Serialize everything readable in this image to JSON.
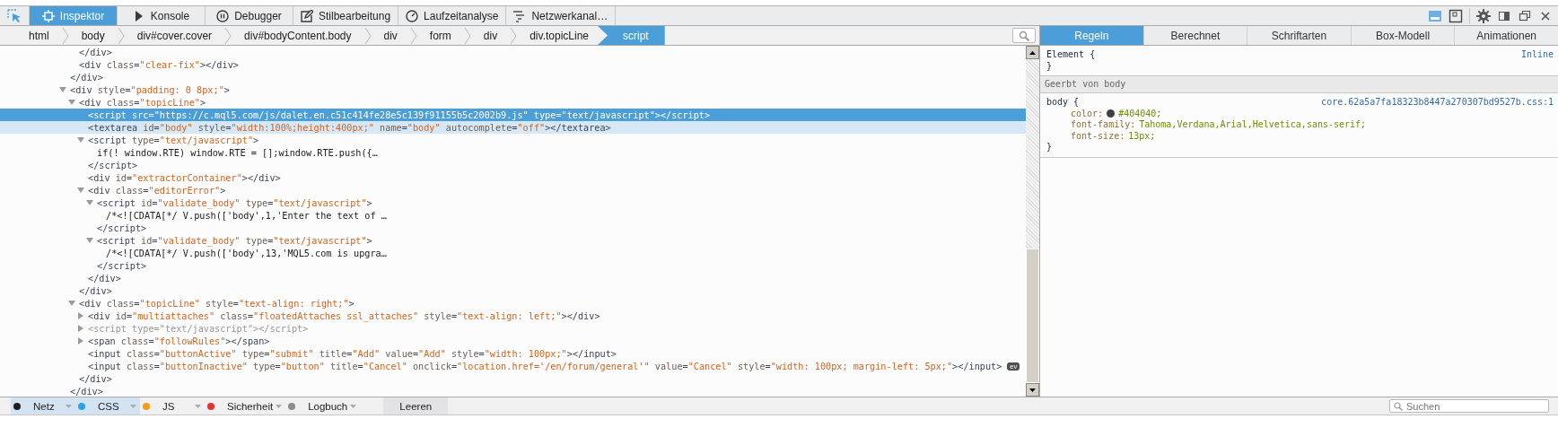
{
  "toolbar": {
    "tabs": [
      {
        "label": "Inspektor",
        "selected": true
      },
      {
        "label": "Konsole",
        "selected": false
      },
      {
        "label": "Debugger",
        "selected": false
      },
      {
        "label": "Stilbearbeitung",
        "selected": false
      },
      {
        "label": "Laufzeitanalyse",
        "selected": false
      },
      {
        "label": "Netzwerkanal…",
        "selected": false
      }
    ]
  },
  "breadcrumbs": [
    {
      "label": "html",
      "selected": false
    },
    {
      "label": "body",
      "selected": false
    },
    {
      "label": "div#cover.cover",
      "selected": false
    },
    {
      "label": "div#bodyContent.body",
      "selected": false
    },
    {
      "label": "div",
      "selected": false
    },
    {
      "label": "form",
      "selected": false
    },
    {
      "label": "div",
      "selected": false
    },
    {
      "label": "div.topicLine",
      "selected": false
    },
    {
      "label": "script",
      "selected": true
    }
  ],
  "markup": [
    {
      "children": [
        {
          "line": [
            {
              "kind": "tag",
              "text": "</div>"
            }
          ],
          "selected": false,
          "hovered": false,
          "dimmed": false
        },
        {
          "line": [
            {
              "kind": "tag",
              "text": "<div"
            },
            {
              "kind": "attr",
              "text": " class"
            },
            {
              "kind": "tag",
              "text": "="
            },
            {
              "kind": "val",
              "text": "\"clear-fix\""
            },
            {
              "kind": "tag",
              "text": "></div>"
            }
          ],
          "selected": false,
          "hovered": false,
          "dimmed": false
        }
      ],
      "close": [
        {
          "kind": "tag",
          "text": "</div>"
        }
      ]
    },
    {
      "line": [
        {
          "kind": "tag",
          "text": "<div"
        },
        {
          "kind": "attr",
          "text": " style"
        },
        {
          "kind": "tag",
          "text": "="
        },
        {
          "kind": "val",
          "text": "\"padding: 0 8px;\""
        },
        {
          "kind": "tag",
          "text": ">"
        }
      ],
      "selected": false,
      "hovered": false,
      "dimmed": false,
      "expanded": true,
      "children": [
        {
          "line": [
            {
              "kind": "tag",
              "text": "<div"
            },
            {
              "kind": "attr",
              "text": " class"
            },
            {
              "kind": "tag",
              "text": "="
            },
            {
              "kind": "val",
              "text": "\"topicLine\""
            },
            {
              "kind": "tag",
              "text": ">"
            }
          ],
          "selected": false,
          "hovered": false,
          "dimmed": false,
          "expanded": true,
          "children": [
            {
              "line": [
                {
                  "kind": "tag",
                  "text": "<script"
                },
                {
                  "kind": "attr",
                  "text": " src"
                },
                {
                  "kind": "tag",
                  "text": "="
                },
                {
                  "kind": "val",
                  "text": "\"https://c.mql5.com/js/dalet.en.c51c414fe28e5c139f91155b5c2002b9.js\""
                },
                {
                  "kind": "attr",
                  "text": " type"
                },
                {
                  "kind": "tag",
                  "text": "="
                },
                {
                  "kind": "val",
                  "text": "\"text/javascript\""
                },
                {
                  "kind": "tag",
                  "text": "></script>"
                }
              ],
              "selected": true,
              "hovered": false,
              "dimmed": false
            },
            {
              "line": [
                {
                  "kind": "tag",
                  "text": "<textarea"
                },
                {
                  "kind": "attr",
                  "text": " id"
                },
                {
                  "kind": "tag",
                  "text": "="
                },
                {
                  "kind": "val",
                  "text": "\"body\""
                },
                {
                  "kind": "attr",
                  "text": " style"
                },
                {
                  "kind": "tag",
                  "text": "="
                },
                {
                  "kind": "val",
                  "text": "\"width:100%;height:400px;\""
                },
                {
                  "kind": "attr",
                  "text": " name"
                },
                {
                  "kind": "tag",
                  "text": "="
                },
                {
                  "kind": "val",
                  "text": "\"body\""
                },
                {
                  "kind": "attr",
                  "text": " autocomplete"
                },
                {
                  "kind": "tag",
                  "text": "="
                },
                {
                  "kind": "val",
                  "text": "\"off\""
                },
                {
                  "kind": "tag",
                  "text": "></textarea>"
                }
              ],
              "selected": false,
              "hovered": true,
              "dimmed": false
            },
            {
              "line": [
                {
                  "kind": "tag",
                  "text": "<script"
                },
                {
                  "kind": "attr",
                  "text": " type"
                },
                {
                  "kind": "tag",
                  "text": "="
                },
                {
                  "kind": "val",
                  "text": "\"text/javascript\""
                },
                {
                  "kind": "tag",
                  "text": ">"
                }
              ],
              "selected": false,
              "hovered": false,
              "dimmed": false,
              "expanded": true,
              "children": [
                {
                  "line": [
                    {
                      "kind": "text",
                      "text": "if(! window.RTE) window.RTE = [];window.RTE.push({…"
                    }
                  ],
                  "selected": false,
                  "hovered": false,
                  "dimmed": false
                }
              ],
              "close": [
                {
                  "kind": "tag",
                  "text": "</script>"
                }
              ]
            },
            {
              "line": [
                {
                  "kind": "tag",
                  "text": "<div"
                },
                {
                  "kind": "attr",
                  "text": " id"
                },
                {
                  "kind": "tag",
                  "text": "="
                },
                {
                  "kind": "val",
                  "text": "\"extractorContainer\""
                },
                {
                  "kind": "tag",
                  "text": "></div>"
                }
              ],
              "selected": false,
              "hovered": false,
              "dimmed": false
            },
            {
              "line": [
                {
                  "kind": "tag",
                  "text": "<div"
                },
                {
                  "kind": "attr",
                  "text": " class"
                },
                {
                  "kind": "tag",
                  "text": "="
                },
                {
                  "kind": "val",
                  "text": "\"editorError\""
                },
                {
                  "kind": "tag",
                  "text": ">"
                }
              ],
              "selected": false,
              "hovered": false,
              "dimmed": false,
              "expanded": true,
              "children": [
                {
                  "line": [
                    {
                      "kind": "tag",
                      "text": "<script"
                    },
                    {
                      "kind": "attr",
                      "text": " id"
                    },
                    {
                      "kind": "tag",
                      "text": "="
                    },
                    {
                      "kind": "val",
                      "text": "\"validate_body\""
                    },
                    {
                      "kind": "attr",
                      "text": " type"
                    },
                    {
                      "kind": "tag",
                      "text": "="
                    },
                    {
                      "kind": "val",
                      "text": "\"text/javascript\""
                    },
                    {
                      "kind": "tag",
                      "text": ">"
                    }
                  ],
                  "selected": false,
                  "hovered": false,
                  "dimmed": false,
                  "expanded": true,
                  "children": [
                    {
                      "line": [
                        {
                          "kind": "text",
                          "text": "/*<![CDATA[*/ V.push(['body',1,'Enter the text of …"
                        }
                      ],
                      "selected": false,
                      "hovered": false,
                      "dimmed": false
                    }
                  ],
                  "close": [
                    {
                      "kind": "tag",
                      "text": "</script>"
                    }
                  ]
                },
                {
                  "line": [
                    {
                      "kind": "tag",
                      "text": "<script"
                    },
                    {
                      "kind": "attr",
                      "text": " id"
                    },
                    {
                      "kind": "tag",
                      "text": "="
                    },
                    {
                      "kind": "val",
                      "text": "\"validate_body\""
                    },
                    {
                      "kind": "attr",
                      "text": " type"
                    },
                    {
                      "kind": "tag",
                      "text": "="
                    },
                    {
                      "kind": "val",
                      "text": "\"text/javascript\""
                    },
                    {
                      "kind": "tag",
                      "text": ">"
                    }
                  ],
                  "selected": false,
                  "hovered": false,
                  "dimmed": false,
                  "expanded": true,
                  "children": [
                    {
                      "line": [
                        {
                          "kind": "text",
                          "text": "/*<![CDATA[*/ V.push(['body',13,'MQL5.com is upgra…"
                        }
                      ],
                      "selected": false,
                      "hovered": false,
                      "dimmed": false
                    }
                  ],
                  "close": [
                    {
                      "kind": "tag",
                      "text": "</script>"
                    }
                  ]
                }
              ],
              "close": [
                {
                  "kind": "tag",
                  "text": "</div>"
                }
              ]
            }
          ],
          "close": [
            {
              "kind": "tag",
              "text": "</div>"
            }
          ]
        },
        {
          "line": [
            {
              "kind": "tag",
              "text": "<div"
            },
            {
              "kind": "attr",
              "text": " class"
            },
            {
              "kind": "tag",
              "text": "="
            },
            {
              "kind": "val",
              "text": "\"topicLine\""
            },
            {
              "kind": "attr",
              "text": " style"
            },
            {
              "kind": "tag",
              "text": "="
            },
            {
              "kind": "val",
              "text": "\"text-align: right;\""
            },
            {
              "kind": "tag",
              "text": ">"
            }
          ],
          "selected": false,
          "hovered": false,
          "dimmed": false,
          "expanded": true,
          "children": [
            {
              "line": [
                {
                  "kind": "tag",
                  "text": "<div"
                },
                {
                  "kind": "attr",
                  "text": " id"
                },
                {
                  "kind": "tag",
                  "text": "="
                },
                {
                  "kind": "val",
                  "text": "\"multiattaches\""
                },
                {
                  "kind": "attr",
                  "text": " class"
                },
                {
                  "kind": "tag",
                  "text": "="
                },
                {
                  "kind": "val",
                  "text": "\"floatedAttaches ssl_attaches\""
                },
                {
                  "kind": "attr",
                  "text": " style"
                },
                {
                  "kind": "tag",
                  "text": "="
                },
                {
                  "kind": "val",
                  "text": "\"text-align: left;\""
                },
                {
                  "kind": "tag",
                  "text": "></div>"
                }
              ],
              "selected": false,
              "hovered": false,
              "dimmed": false,
              "expanded": false
            },
            {
              "line": [
                {
                  "kind": "tag",
                  "text": "<script"
                },
                {
                  "kind": "attr",
                  "text": " type"
                },
                {
                  "kind": "tag",
                  "text": "="
                },
                {
                  "kind": "val",
                  "text": "\"text/javascript\""
                },
                {
                  "kind": "tag",
                  "text": "></script>"
                }
              ],
              "selected": false,
              "hovered": false,
              "dimmed": true,
              "expanded": false
            },
            {
              "line": [
                {
                  "kind": "tag",
                  "text": "<span"
                },
                {
                  "kind": "attr",
                  "text": " class"
                },
                {
                  "kind": "tag",
                  "text": "="
                },
                {
                  "kind": "val",
                  "text": "\"followRules\""
                },
                {
                  "kind": "tag",
                  "text": "></span>"
                }
              ],
              "selected": false,
              "hovered": false,
              "dimmed": false,
              "expanded": false
            },
            {
              "line": [
                {
                  "kind": "tag",
                  "text": "<input"
                },
                {
                  "kind": "attr",
                  "text": " class"
                },
                {
                  "kind": "tag",
                  "text": "="
                },
                {
                  "kind": "val",
                  "text": "\"buttonActive\""
                },
                {
                  "kind": "attr",
                  "text": " type"
                },
                {
                  "kind": "tag",
                  "text": "="
                },
                {
                  "kind": "val",
                  "text": "\"submit\""
                },
                {
                  "kind": "attr",
                  "text": " title"
                },
                {
                  "kind": "tag",
                  "text": "="
                },
                {
                  "kind": "val",
                  "text": "\"Add\""
                },
                {
                  "kind": "attr",
                  "text": " value"
                },
                {
                  "kind": "tag",
                  "text": "="
                },
                {
                  "kind": "val",
                  "text": "\"Add\""
                },
                {
                  "kind": "attr",
                  "text": " style"
                },
                {
                  "kind": "tag",
                  "text": "="
                },
                {
                  "kind": "val",
                  "text": "\"width: 100px;\""
                },
                {
                  "kind": "tag",
                  "text": "></input>"
                }
              ],
              "selected": false,
              "hovered": false,
              "dimmed": false
            },
            {
              "line": [
                {
                  "kind": "tag",
                  "text": "<input"
                },
                {
                  "kind": "attr",
                  "text": " class"
                },
                {
                  "kind": "tag",
                  "text": "="
                },
                {
                  "kind": "val",
                  "text": "\"buttonInactive\""
                },
                {
                  "kind": "attr",
                  "text": " type"
                },
                {
                  "kind": "tag",
                  "text": "="
                },
                {
                  "kind": "val",
                  "text": "\"button\""
                },
                {
                  "kind": "attr",
                  "text": " title"
                },
                {
                  "kind": "tag",
                  "text": "="
                },
                {
                  "kind": "val",
                  "text": "\"Cancel\""
                },
                {
                  "kind": "attr",
                  "text": " onclick"
                },
                {
                  "kind": "tag",
                  "text": "="
                },
                {
                  "kind": "val",
                  "text": "\"location.href='/en/forum/general'\""
                },
                {
                  "kind": "attr",
                  "text": " value"
                },
                {
                  "kind": "tag",
                  "text": "="
                },
                {
                  "kind": "val",
                  "text": "\"Cancel\""
                },
                {
                  "kind": "attr",
                  "text": " style"
                },
                {
                  "kind": "tag",
                  "text": "="
                },
                {
                  "kind": "val",
                  "text": "\"width: 100px; margin-left: 5px;\""
                },
                {
                  "kind": "tag",
                  "text": "></input>"
                }
              ],
              "selected": false,
              "hovered": false,
              "dimmed": false,
              "badge": "ev"
            }
          ],
          "close": [
            {
              "kind": "tag",
              "text": "</div>"
            }
          ]
        }
      ],
      "close": [
        {
          "kind": "tag",
          "text": "</div>"
        }
      ]
    }
  ],
  "sidebar": {
    "tabs": [
      {
        "label": "Regeln",
        "selected": true
      },
      {
        "label": "Berechnet",
        "selected": false
      },
      {
        "label": "Schriftarten",
        "selected": false
      },
      {
        "label": "Box-Modell",
        "selected": false
      },
      {
        "label": "Animationen",
        "selected": false
      }
    ],
    "rules": [
      {
        "kind": "rule",
        "selector": "Element {",
        "source": "Inline",
        "close": "}"
      },
      {
        "kind": "header",
        "text": "Geerbt von body"
      },
      {
        "kind": "rule",
        "selector": "body {",
        "source": "core.62a5a7fa18323b8447a270307bd9527b.css:1",
        "close": "}",
        "declarations": [
          {
            "property": "color:",
            "value": "#404040;",
            "color": "#404040"
          },
          {
            "property": "font-family:",
            "value": "Tahoma,Verdana,Arial,Helvetica,sans-serif;"
          },
          {
            "property": "font-size:",
            "value": "13px;"
          }
        ]
      }
    ]
  },
  "console": {
    "filters": [
      {
        "label": "Netz",
        "color": "#1e1e1e",
        "selected": true
      },
      {
        "label": "CSS",
        "color": "#2aa3e0",
        "selected": true
      },
      {
        "label": "JS",
        "color": "#f59a1b",
        "selected": false
      },
      {
        "label": "Sicherheit",
        "color": "#e8312f",
        "selected": false
      },
      {
        "label": "Logbuch",
        "color": "#8c8c8c",
        "selected": false
      }
    ],
    "clear_button": "Leeren",
    "search": {
      "placeholder": "Suchen"
    }
  }
}
